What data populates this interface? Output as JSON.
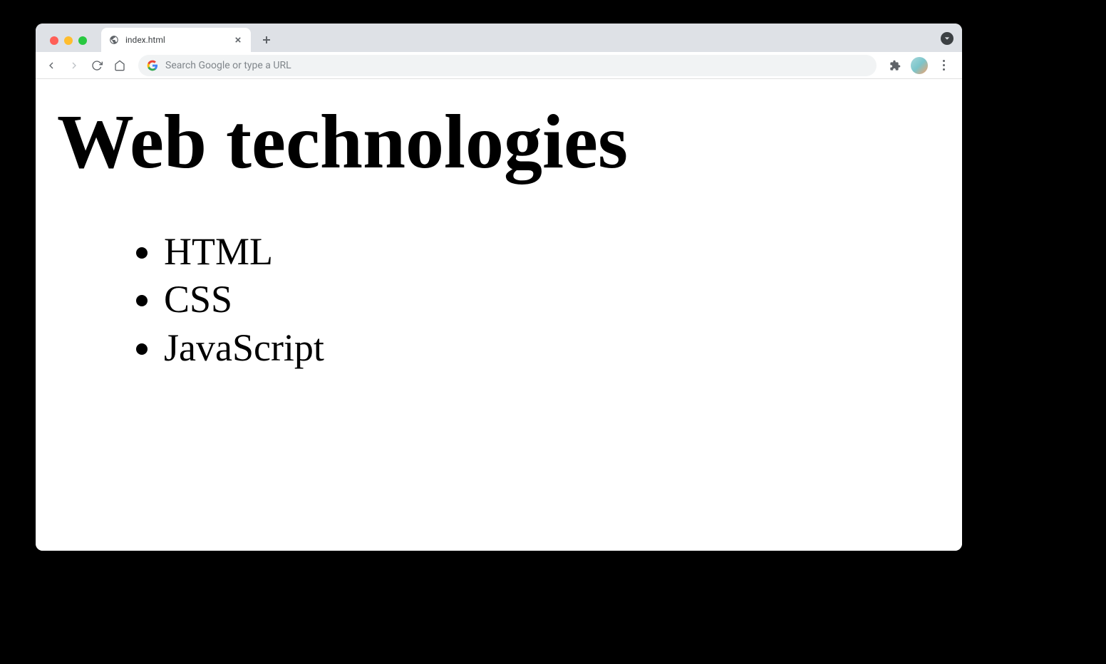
{
  "tab": {
    "title": "index.html"
  },
  "addressBar": {
    "placeholder": "Search Google or type a URL"
  },
  "page": {
    "heading": "Web technologies",
    "items": [
      "HTML",
      "CSS",
      "JavaScript"
    ]
  }
}
